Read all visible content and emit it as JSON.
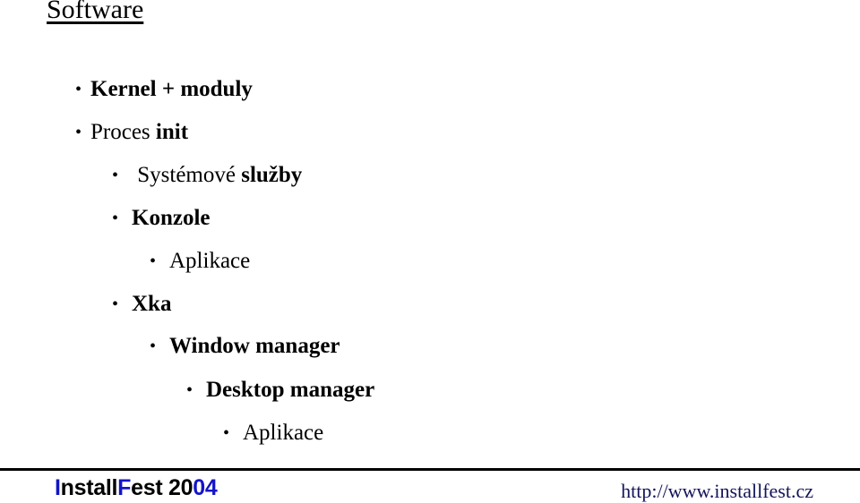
{
  "slide": {
    "title": "Software",
    "items": [
      {
        "bullet": "•",
        "parts": [
          {
            "text": "Kernel + moduly",
            "bold": true
          }
        ]
      },
      {
        "bullet": "•",
        "parts": [
          {
            "text": "Proces ",
            "bold": false
          },
          {
            "text": "init",
            "bold": true
          }
        ]
      },
      {
        "bullet": "•",
        "parts": [
          {
            "text": " Systémové ",
            "bold": false
          },
          {
            "text": "služby",
            "bold": true
          }
        ]
      },
      {
        "bullet": "•",
        "parts": [
          {
            "text": "Konzole",
            "bold": true
          }
        ]
      },
      {
        "bullet": "•",
        "parts": [
          {
            "text": "Aplikace",
            "bold": false
          }
        ]
      },
      {
        "bullet": "•",
        "parts": [
          {
            "text": "Xka",
            "bold": true
          }
        ]
      },
      {
        "bullet": "•",
        "parts": [
          {
            "text": "Window manager",
            "bold": true
          }
        ]
      },
      {
        "bullet": "•",
        "parts": [
          {
            "text": "Desktop manager",
            "bold": true
          }
        ]
      },
      {
        "bullet": "•",
        "parts": [
          {
            "text": "Aplikace",
            "bold": false
          }
        ]
      }
    ]
  },
  "footer": {
    "brand_parts": [
      {
        "text": "I",
        "color": "#1414c8"
      },
      {
        "text": "nstall",
        "color": "#000000"
      },
      {
        "text": "F",
        "color": "#1414c8"
      },
      {
        "text": "est 20",
        "color": "#000000"
      },
      {
        "text": "04",
        "color": "#1414c8"
      }
    ],
    "url": "http://www.installfest.cz",
    "url_color": "#14145a"
  }
}
